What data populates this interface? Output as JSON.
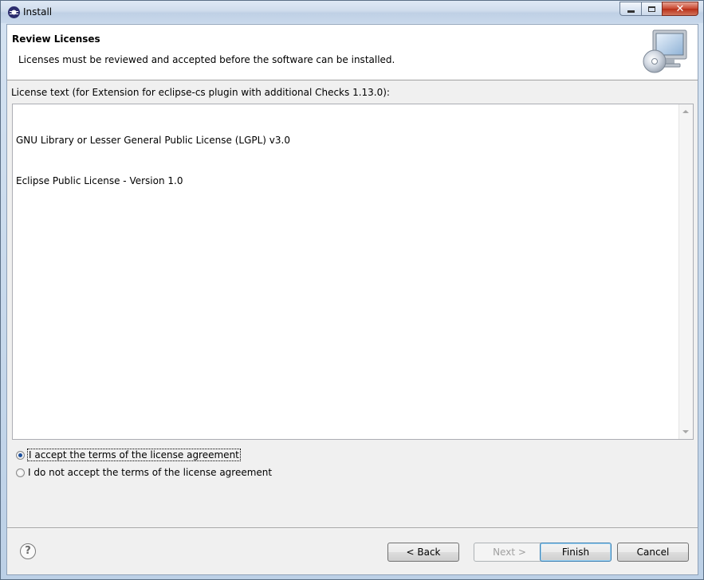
{
  "window": {
    "title": "Install"
  },
  "banner": {
    "title": "Review Licenses",
    "description": "Licenses must be reviewed and accepted before the software can be installed.",
    "icon": "install-monitor-icon"
  },
  "license": {
    "label": "License text (for Extension for eclipse-cs plugin with additional Checks 1.13.0):",
    "lines": [
      "GNU Library or Lesser General Public License (LGPL) v3.0",
      "Eclipse Public License - Version 1.0"
    ]
  },
  "options": {
    "accept": "I accept the terms of the license agreement",
    "decline": "I do not accept the terms of the license agreement",
    "selected": "accept"
  },
  "buttons": {
    "back": "< Back",
    "next": "Next >",
    "finish": "Finish",
    "cancel": "Cancel"
  },
  "colors": {
    "accent": "#3c7fb1",
    "close": "#c8462f"
  }
}
